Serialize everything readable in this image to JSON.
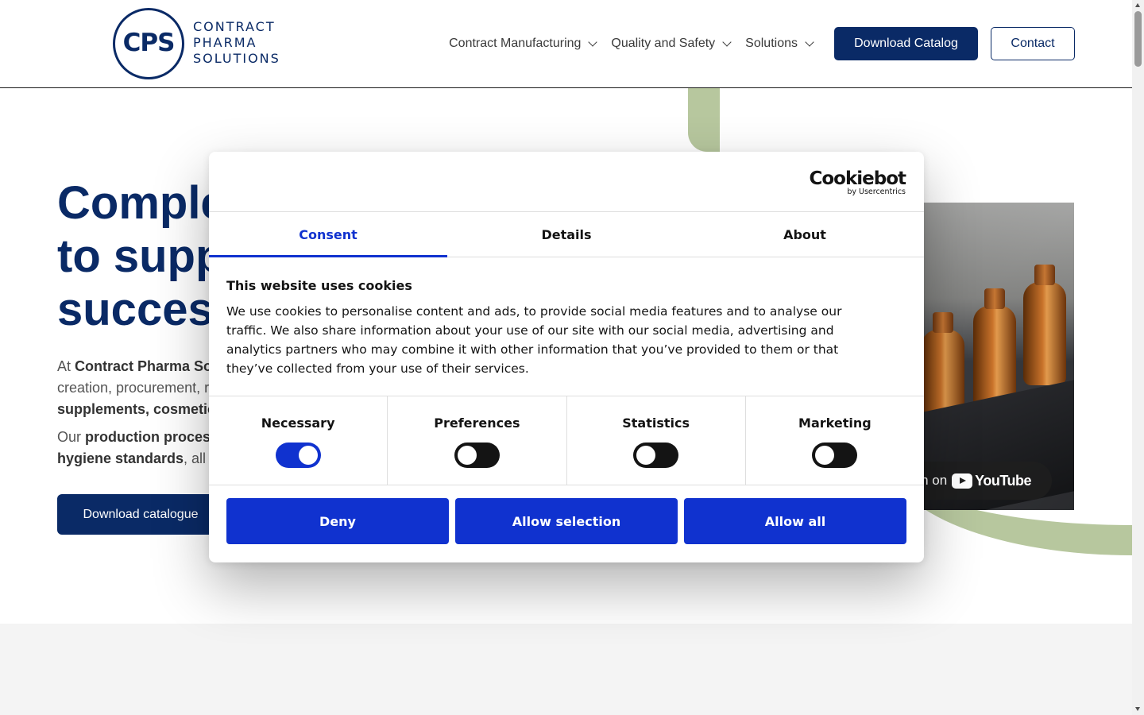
{
  "logo": {
    "initials": "CPS",
    "words": [
      "CONTRACT",
      "PHARMA",
      "SOLUTIONS"
    ]
  },
  "nav": {
    "items": [
      {
        "label": "Contract Manufacturing"
      },
      {
        "label": "Quality and Safety"
      },
      {
        "label": "Solutions"
      }
    ],
    "catalog_label": "Download Catalog",
    "contact_label": "Contact"
  },
  "hero": {
    "title_lines": [
      "Comple",
      "to supp",
      "success"
    ],
    "p1": {
      "line1_prefix": "At ",
      "line1_bold": "Contract Pharma Sol",
      "line2": "creation, procurement, r",
      "line3_bold": "supplements, cosmetics"
    },
    "p2": {
      "line1_prefix": "Our ",
      "line1_bold": "production process",
      "line2_bold": "hygiene standards",
      "line2_rest": ", all c"
    },
    "button_label": "Download catalogue"
  },
  "video": {
    "watch_label": "tch on",
    "youtube_label": "YouTube"
  },
  "cookie_dialog": {
    "brand": "Cookiebot",
    "brand_sub": "by Usercentrics",
    "tabs": [
      {
        "label": "Consent",
        "active": true
      },
      {
        "label": "Details",
        "active": false
      },
      {
        "label": "About",
        "active": false
      }
    ],
    "heading": "This website uses cookies",
    "body_lines": [
      "We use cookies to personalise content and ads, to provide social media features and to analyse our",
      "traffic. We also share information about your use of our site with our social media, advertising and",
      "analytics partners who may combine it with other information that you’ve provided to them or that",
      "they’ve collected from your use of their services."
    ],
    "toggles": [
      {
        "label": "Necessary",
        "state": "on"
      },
      {
        "label": "Preferences",
        "state": "off"
      },
      {
        "label": "Statistics",
        "state": "off"
      },
      {
        "label": "Marketing",
        "state": "off"
      }
    ],
    "buttons": {
      "deny": "Deny",
      "allow_selection": "Allow selection",
      "allow_all": "Allow all"
    }
  },
  "colors": {
    "brand_navy": "#0a2a66",
    "cookiebot_blue": "#1032cf",
    "accent_green": "#b7c79e"
  }
}
